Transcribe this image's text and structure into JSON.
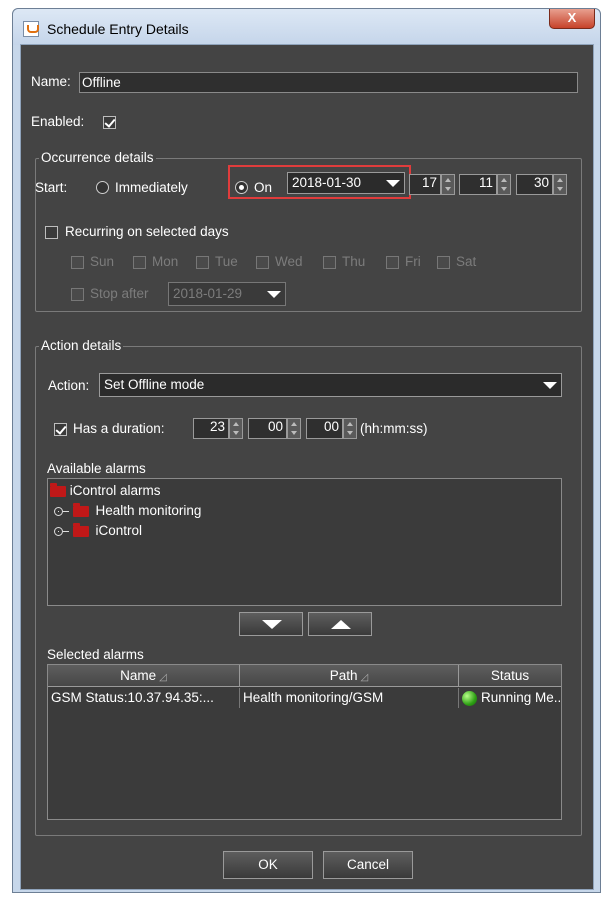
{
  "window": {
    "title": "Schedule Entry Details",
    "close_glyph": "X"
  },
  "form": {
    "name_label": "Name:",
    "name_value": "Offline",
    "enabled_label": "Enabled:",
    "enabled_checked": true
  },
  "occurrence": {
    "group_title": "Occurrence details",
    "start_label": "Start:",
    "immediately_label": "Immediately",
    "on_label": "On",
    "selected_start": "On",
    "date_value": "2018-01-30",
    "hour": "17",
    "minute": "11",
    "second": "30",
    "recurring_label": "Recurring on selected days",
    "recurring_checked": false,
    "days": [
      "Sun",
      "Mon",
      "Tue",
      "Wed",
      "Thu",
      "Fri",
      "Sat"
    ],
    "stop_after_label": "Stop after",
    "stop_after_date": "2018-01-29"
  },
  "action": {
    "group_title": "Action details",
    "action_label": "Action:",
    "action_value": "Set Offline mode",
    "duration_label": "Has a duration:",
    "duration_checked": true,
    "duration_h": "23",
    "duration_m": "00",
    "duration_s": "00",
    "duration_unit": "(hh:mm:ss)",
    "available_label": "Available alarms",
    "tree": {
      "root": "iControl alarms",
      "children": [
        "Health monitoring",
        "iControl"
      ]
    },
    "selected_label": "Selected alarms",
    "table": {
      "columns": [
        "Name",
        "Path",
        "Status"
      ],
      "rows": [
        {
          "name": "GSM Status:10.37.94.35:...",
          "path": "Health monitoring/GSM",
          "status": "Running Me..."
        }
      ]
    }
  },
  "buttons": {
    "ok": "OK",
    "cancel": "Cancel"
  },
  "colors": {
    "highlight": "#e03c3c",
    "background": "#444444",
    "status_ok": "#2ea014"
  }
}
